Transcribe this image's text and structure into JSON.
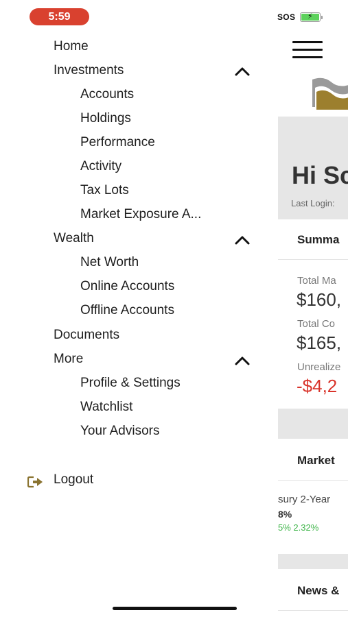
{
  "status_bar": {
    "time": "5:59",
    "sos": "SOS",
    "battery_color": "#5dd25c"
  },
  "drawer": {
    "items": [
      {
        "label": "Home",
        "level": 1
      },
      {
        "label": "Investments",
        "level": 1,
        "expanded": true,
        "icon": "chevron-up-icon"
      },
      {
        "label": "Accounts",
        "level": 2
      },
      {
        "label": "Holdings",
        "level": 2
      },
      {
        "label": "Performance",
        "level": 2
      },
      {
        "label": "Activity",
        "level": 2
      },
      {
        "label": "Tax Lots",
        "level": 2
      },
      {
        "label": "Market Exposure A...",
        "level": 2
      },
      {
        "label": "Wealth",
        "level": 1,
        "expanded": true,
        "icon": "chevron-up-icon"
      },
      {
        "label": "Net Worth",
        "level": 2
      },
      {
        "label": "Online Accounts",
        "level": 2
      },
      {
        "label": "Offline Accounts",
        "level": 2
      },
      {
        "label": "Documents",
        "level": 1
      },
      {
        "label": "More",
        "level": 1,
        "expanded": true,
        "icon": "chevron-up-icon"
      },
      {
        "label": "Profile & Settings",
        "level": 2
      },
      {
        "label": "Watchlist",
        "level": 2
      },
      {
        "label": "Your Advisors",
        "level": 2
      }
    ],
    "logout": {
      "label": "Logout",
      "icon": "logout-icon",
      "icon_color": "#8a7330"
    }
  },
  "background_app": {
    "menu_icon": "hamburger-icon",
    "logo_icon": "brand-flag-logo",
    "brand_colors": {
      "logo_gray": "#9a9a9a",
      "logo_gold": "#9c7f2e"
    },
    "greeting": "Hi Sc",
    "last_login": "Last Login:",
    "summary_title": "Summa",
    "stats": [
      {
        "label": "Total Ma",
        "value": "$160,"
      },
      {
        "label": "Total Co",
        "value": "$165,"
      },
      {
        "label": "Unrealize",
        "value": "-$4,2",
        "negative": true
      }
    ],
    "negative_color": "#d9342b",
    "market_title": "Market",
    "market": {
      "name": "sury 2-Year",
      "value": "8%",
      "change": "5%   2.32%",
      "change_color": "#3fb54a"
    },
    "news_title": "News &"
  }
}
